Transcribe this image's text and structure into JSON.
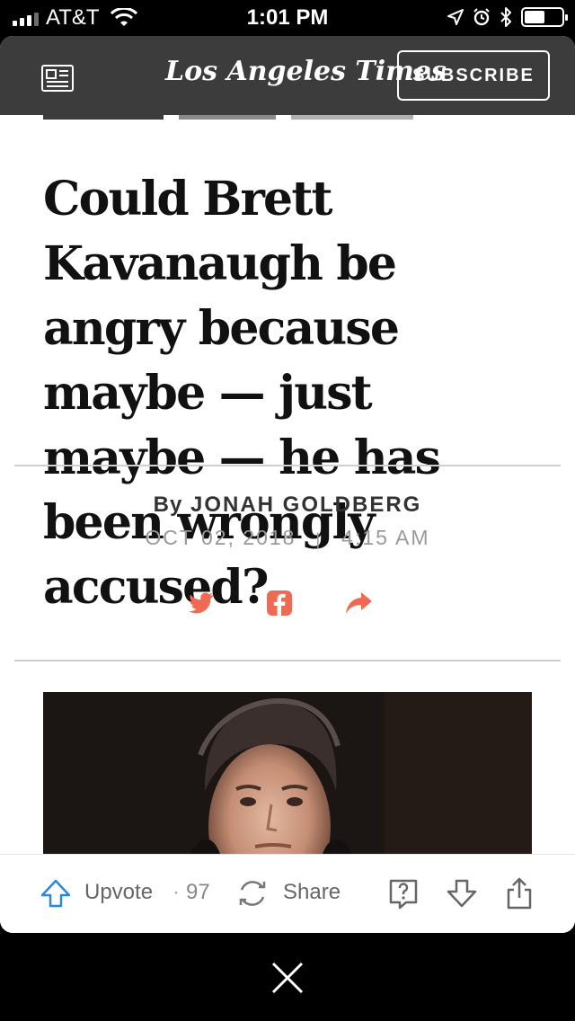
{
  "status_bar": {
    "carrier": "AT&T",
    "time": "1:01 PM"
  },
  "header": {
    "masthead": "Los Angeles Times",
    "subscribe_label": "SUBSCRIBE"
  },
  "article": {
    "headline": "Could Brett Kavanaugh be angry because maybe — just maybe — he has been wrongly accused?",
    "byline_prefix": "By",
    "author": "JONAH GOLDBERG",
    "date": "OCT 02, 2018",
    "date_separator": "|",
    "time": "4:15 AM"
  },
  "social_icons": [
    "twitter-icon",
    "facebook-icon",
    "share-arrow-icon"
  ],
  "action_bar": {
    "upvote_label": "Upvote",
    "upvote_separator": "·",
    "upvote_count": "97",
    "share_label": "Share"
  },
  "colors": {
    "header_bg": "#3c3c3c",
    "social_accent": "#ef6a53",
    "upvote_accent": "#2b87d9"
  }
}
